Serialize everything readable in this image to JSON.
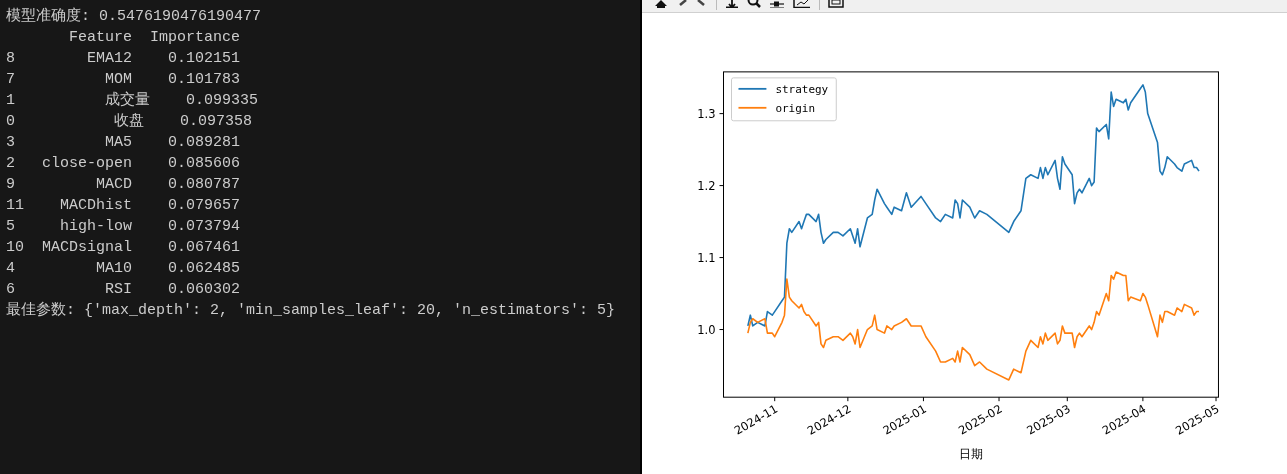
{
  "terminal": {
    "lines": [
      "模型准确度: 0.5476190476190477",
      "       Feature  Importance",
      "8        EMA12    0.102151",
      "7          MOM    0.101783",
      "1          成交量    0.099335",
      "0           收盘    0.097358",
      "3          MA5    0.089281",
      "2   close-open    0.085606",
      "9         MACD    0.080787",
      "11    MACDhist    0.079657",
      "5     high-low    0.073794",
      "10  MACDsignal    0.067461",
      "4         MA10    0.062485",
      "6          RSI    0.060302",
      "最佳参数: {'max_depth': 2, 'min_samples_leaf': 20, 'n_estimators': 5}"
    ]
  },
  "figure": {
    "chart_data": {
      "type": "line",
      "xlabel": "日期",
      "x": [
        "2024-10-21",
        "2024-10-22",
        "2024-10-23",
        "2024-10-25",
        "2024-10-28",
        "2024-10-29",
        "2024-10-31",
        "2024-11-01",
        "2024-11-04",
        "2024-11-05",
        "2024-11-06",
        "2024-11-07",
        "2024-11-08",
        "2024-11-11",
        "2024-11-12",
        "2024-11-13",
        "2024-11-14",
        "2024-11-15",
        "2024-11-18",
        "2024-11-19",
        "2024-11-20",
        "2024-11-21",
        "2024-11-22",
        "2024-11-25",
        "2024-11-27",
        "2024-11-29",
        "2024-12-02",
        "2024-12-03",
        "2024-12-04",
        "2024-12-05",
        "2024-12-06",
        "2024-12-09",
        "2024-12-11",
        "2024-12-12",
        "2024-12-13",
        "2024-12-16",
        "2024-12-17",
        "2024-12-19",
        "2024-12-20",
        "2024-12-23",
        "2024-12-25",
        "2024-12-27",
        "2024-12-31",
        "2025-01-02",
        "2025-01-06",
        "2025-01-08",
        "2025-01-10",
        "2025-01-13",
        "2025-01-14",
        "2025-01-15",
        "2025-01-16",
        "2025-01-17",
        "2025-01-20",
        "2025-01-22",
        "2025-01-24",
        "2025-01-27",
        "2025-02-05",
        "2025-02-07",
        "2025-02-10",
        "2025-02-12",
        "2025-02-14",
        "2025-02-17",
        "2025-02-18",
        "2025-02-19",
        "2025-02-20",
        "2025-02-21",
        "2025-02-24",
        "2025-02-25",
        "2025-02-26",
        "2025-02-27",
        "2025-02-28",
        "2025-03-03",
        "2025-03-04",
        "2025-03-05",
        "2025-03-06",
        "2025-03-07",
        "2025-03-10",
        "2025-03-11",
        "2025-03-12",
        "2025-03-13",
        "2025-03-14",
        "2025-03-17",
        "2025-03-18",
        "2025-03-19",
        "2025-03-20",
        "2025-03-21",
        "2025-03-24",
        "2025-03-25",
        "2025-03-26",
        "2025-03-27",
        "2025-03-31",
        "2025-04-01",
        "2025-04-02",
        "2025-04-03",
        "2025-04-07",
        "2025-04-08",
        "2025-04-09",
        "2025-04-10",
        "2025-04-11",
        "2025-04-14",
        "2025-04-15",
        "2025-04-17",
        "2025-04-18",
        "2025-04-21",
        "2025-04-22",
        "2025-04-23",
        "2025-04-24"
      ],
      "series": [
        {
          "name": "strategy",
          "color": "#1f77b4",
          "values": [
            1.005,
            1.02,
            1.005,
            1.01,
            1.005,
            1.025,
            1.02,
            1.025,
            1.04,
            1.045,
            1.12,
            1.14,
            1.135,
            1.15,
            1.14,
            1.15,
            1.16,
            1.16,
            1.15,
            1.16,
            1.135,
            1.12,
            1.125,
            1.135,
            1.135,
            1.13,
            1.14,
            1.13,
            1.12,
            1.14,
            1.115,
            1.155,
            1.16,
            1.18,
            1.195,
            1.175,
            1.17,
            1.16,
            1.17,
            1.165,
            1.19,
            1.17,
            1.185,
            1.175,
            1.155,
            1.15,
            1.16,
            1.155,
            1.18,
            1.175,
            1.155,
            1.18,
            1.17,
            1.155,
            1.165,
            1.16,
            1.135,
            1.15,
            1.165,
            1.21,
            1.215,
            1.21,
            1.225,
            1.21,
            1.225,
            1.215,
            1.235,
            1.21,
            1.195,
            1.24,
            1.23,
            1.215,
            1.175,
            1.19,
            1.195,
            1.19,
            1.21,
            1.2,
            1.205,
            1.28,
            1.275,
            1.285,
            1.265,
            1.33,
            1.31,
            1.32,
            1.315,
            1.32,
            1.305,
            1.315,
            1.335,
            1.34,
            1.33,
            1.3,
            1.26,
            1.22,
            1.215,
            1.225,
            1.24,
            1.23,
            1.225,
            1.22,
            1.23,
            1.235,
            1.225,
            1.225,
            1.22
          ]
        },
        {
          "name": "origin",
          "color": "#ff7f0e",
          "values": [
            0.995,
            1.01,
            1.015,
            1.01,
            1.015,
            0.995,
            0.995,
            0.99,
            1.01,
            1.02,
            1.07,
            1.045,
            1.04,
            1.03,
            1.035,
            1.025,
            1.02,
            1.02,
            1.005,
            1.01,
            0.98,
            0.975,
            0.985,
            0.99,
            0.99,
            0.985,
            0.995,
            0.99,
            0.98,
            1.0,
            0.975,
            1.0,
            1.005,
            1.02,
            1.0,
            0.995,
            1.005,
            1.0,
            1.005,
            1.01,
            1.015,
            1.005,
            1.005,
            0.99,
            0.97,
            0.955,
            0.955,
            0.96,
            0.955,
            0.97,
            0.955,
            0.975,
            0.965,
            0.95,
            0.955,
            0.945,
            0.93,
            0.945,
            0.94,
            0.97,
            0.985,
            0.975,
            0.99,
            0.98,
            0.995,
            0.985,
            0.995,
            0.98,
            0.985,
            1.005,
            0.995,
            0.995,
            0.975,
            0.99,
            0.995,
            0.99,
            1.005,
            1.0,
            1.01,
            1.025,
            1.02,
            1.05,
            1.04,
            1.075,
            1.07,
            1.08,
            1.075,
            1.075,
            1.04,
            1.045,
            1.04,
            1.05,
            1.045,
            1.035,
            0.99,
            1.02,
            1.01,
            1.025,
            1.025,
            1.02,
            1.03,
            1.025,
            1.035,
            1.03,
            1.02,
            1.025,
            1.025
          ]
        }
      ],
      "xlim": [
        "2024-10-11",
        "2025-05-02"
      ],
      "ylim": [
        0.906,
        1.358
      ],
      "xticks": [
        {
          "value": "2024-11-01",
          "label": "2024-11"
        },
        {
          "value": "2024-12-01",
          "label": "2024-12"
        },
        {
          "value": "2025-01-01",
          "label": "2025-01"
        },
        {
          "value": "2025-02-01",
          "label": "2025-02"
        },
        {
          "value": "2025-03-01",
          "label": "2025-03"
        },
        {
          "value": "2025-04-01",
          "label": "2025-04"
        },
        {
          "value": "2025-05-01",
          "label": "2025-05"
        }
      ],
      "yticks": [
        {
          "value": 1.0,
          "label": "1.0"
        },
        {
          "value": 1.1,
          "label": "1.1"
        },
        {
          "value": 1.2,
          "label": "1.2"
        },
        {
          "value": 1.3,
          "label": "1.3"
        }
      ],
      "legend": true
    }
  }
}
